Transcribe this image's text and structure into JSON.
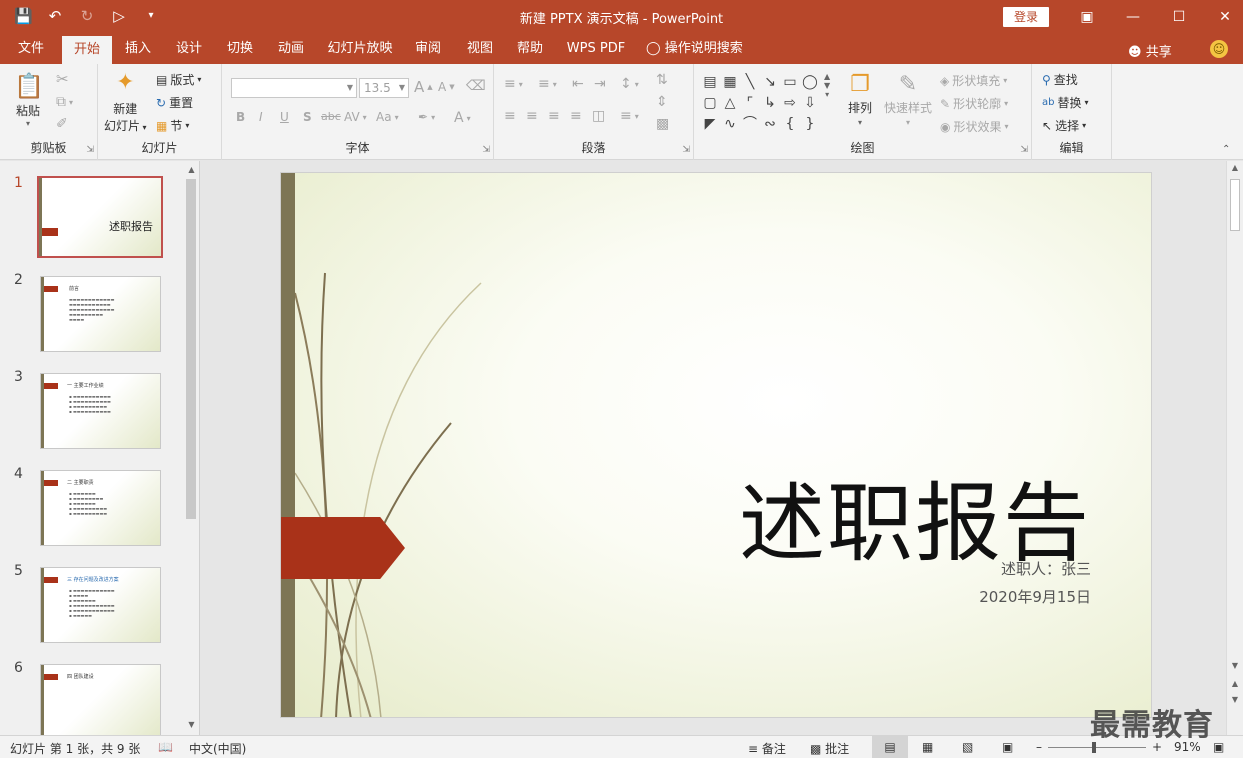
{
  "window": {
    "title": "新建 PPTX 演示文稿  -  PowerPoint",
    "login": "登录",
    "share": "共享"
  },
  "tabs": [
    "文件",
    "开始",
    "插入",
    "设计",
    "切换",
    "动画",
    "幻灯片放映",
    "审阅",
    "视图",
    "帮助",
    "WPS PDF",
    "操作说明搜索"
  ],
  "active_tab": "开始",
  "ribbon": {
    "clipboard": {
      "label": "剪贴板",
      "paste": "粘贴"
    },
    "slides": {
      "label": "幻灯片",
      "new_slide_1": "新建",
      "new_slide_2": "幻灯片",
      "layout": "版式",
      "reset": "重置",
      "section": "节"
    },
    "font": {
      "label": "字体",
      "font_size": "13.5",
      "bold": "B",
      "italic": "I",
      "underline": "U",
      "shadow": "S",
      "strike": "abc",
      "spacing": "AV",
      "case": "Aa",
      "color": "A",
      "grow": "A",
      "shrink": "A"
    },
    "paragraph": {
      "label": "段落"
    },
    "drawing": {
      "label": "绘图",
      "arrange": "排列",
      "quick_styles": "快速样式",
      "fill": "形状填充",
      "outline": "形状轮廓",
      "effects": "形状效果"
    },
    "editing": {
      "label": "编辑",
      "find": "查找",
      "replace": "替换",
      "select": "选择"
    }
  },
  "thumbnails": [
    {
      "num": "1",
      "title": "述职报告",
      "selected": true
    },
    {
      "num": "2",
      "head": "前言"
    },
    {
      "num": "3",
      "head": "一  主要工作业绩"
    },
    {
      "num": "4",
      "head": "二  主要职责"
    },
    {
      "num": "5",
      "head": "三  存在问题及改进方案"
    },
    {
      "num": "6",
      "head": "四  团队建设"
    }
  ],
  "slide": {
    "title": "述职报告",
    "presenter": "述职人：张三",
    "date": "2020年9月15日"
  },
  "status": {
    "slide_info": "幻灯片 第 1 张，共 9 张",
    "language": "中文(中国)",
    "notes": "备注",
    "comments": "批注",
    "zoom": "91%"
  },
  "watermark": "最需教育",
  "colors": {
    "accent": "#b7472a",
    "flag": "#a93219",
    "bar": "#7d7555"
  }
}
